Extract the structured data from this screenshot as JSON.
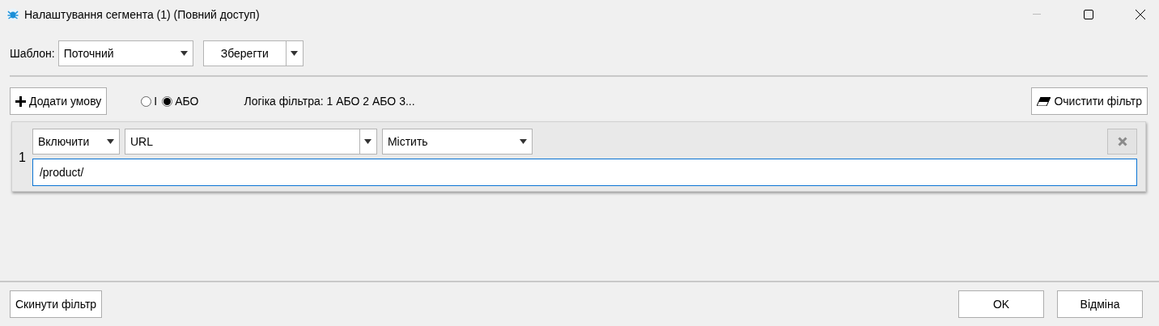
{
  "window": {
    "title": "Налаштування сегмента (1) (Повний доступ)"
  },
  "template": {
    "label": "Шаблон:",
    "value": "Поточний",
    "save_button": "Зберегти"
  },
  "toolbar": {
    "add_button": "Додати умову",
    "logic_options": [
      {
        "label": "І",
        "selected": false
      },
      {
        "label": "АБО",
        "selected": true
      }
    ],
    "logic_text": "Логіка фільтра: 1 АБО 2 АБО 3...",
    "clear_button": "Очистити фільтр"
  },
  "conditions": [
    {
      "number": "1",
      "mode": "Включити",
      "field": "URL",
      "operator": "Містить",
      "value": "/product/"
    }
  ],
  "footer": {
    "reset_button": "Скинути фільтр",
    "ok_button": "OK",
    "cancel_button": "Відміна"
  }
}
